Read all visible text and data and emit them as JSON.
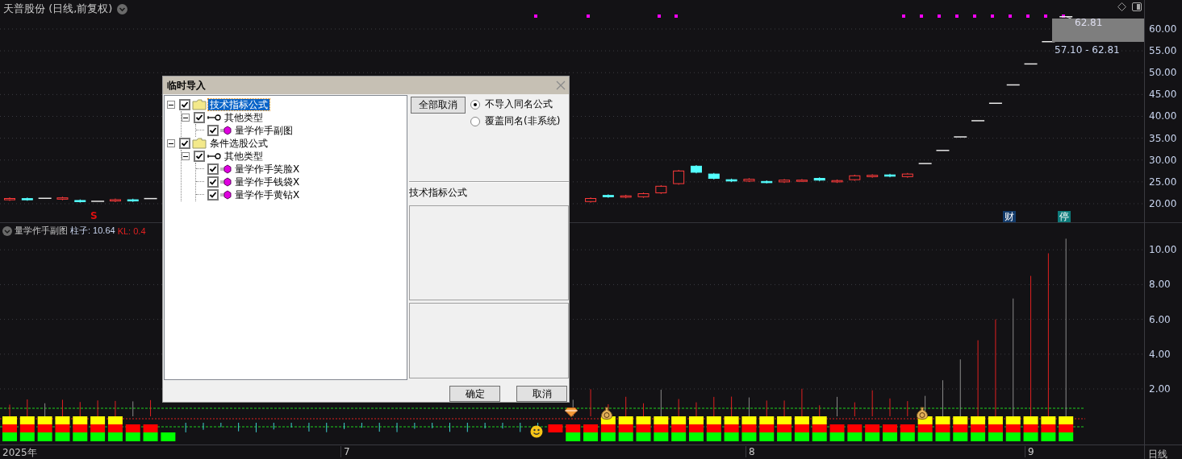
{
  "chart_header": {
    "title": "天普股份 (日线,前复权)"
  },
  "price_panel": {
    "axis_labels": [
      "60.00",
      "55.00",
      "50.00",
      "45.00",
      "40.00",
      "35.00",
      "30.00",
      "25.00",
      "20.00"
    ],
    "high_label": "62.81",
    "range_label": "57.10 - 62.81",
    "signal_mark": "S",
    "badges": [
      {
        "text": "财",
        "color": "#123a6a"
      },
      {
        "text": "停",
        "color": "#0e7b7b"
      }
    ]
  },
  "indicator_panel": {
    "title": "量学作手副图",
    "readings": [
      {
        "label": "柱子: 10.64",
        "color": "#c8d4ee"
      },
      {
        "label": "KL: 0.4",
        "color": "#e02020"
      }
    ],
    "axis_labels": [
      "10.00",
      "8.00",
      "6.00",
      "4.00",
      "2.00"
    ]
  },
  "time_axis": {
    "labels": [
      "2025年",
      "7",
      "8",
      "9"
    ],
    "period": "日线"
  },
  "dialog": {
    "title": "临时导入",
    "tree": [
      {
        "label": "技术指标公式",
        "kind": "folder",
        "checked": true,
        "expanded": true,
        "selected": true,
        "children": [
          {
            "label": "其他类型",
            "kind": "type",
            "checked": true,
            "expanded": true,
            "selected": false,
            "children": [
              {
                "label": "量学作手副图",
                "kind": "formula",
                "checked": true,
                "selected": false
              }
            ]
          }
        ]
      },
      {
        "label": "条件选股公式",
        "kind": "folder",
        "checked": true,
        "expanded": true,
        "selected": false,
        "children": [
          {
            "label": "其他类型",
            "kind": "type",
            "checked": true,
            "expanded": true,
            "selected": false,
            "children": [
              {
                "label": "量学作手笑脸X",
                "kind": "formula",
                "checked": true,
                "selected": false
              },
              {
                "label": "量学作手钱袋X",
                "kind": "formula",
                "checked": true,
                "selected": false
              },
              {
                "label": "量学作手黄钻X",
                "kind": "formula",
                "checked": true,
                "selected": false
              }
            ]
          }
        ]
      }
    ],
    "clear_button": "全部取消",
    "options": [
      {
        "label": "不导入同名公式",
        "selected": true
      },
      {
        "label": "覆盖同名(非系统)",
        "selected": false
      }
    ],
    "section_label": "技术指标公式",
    "buttons": [
      "确定",
      "取消"
    ]
  }
}
